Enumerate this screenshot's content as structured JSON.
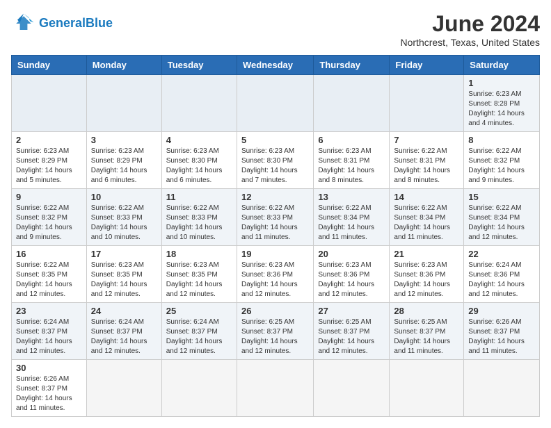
{
  "header": {
    "logo_general": "General",
    "logo_blue": "Blue",
    "month_title": "June 2024",
    "location": "Northcrest, Texas, United States"
  },
  "days_of_week": [
    "Sunday",
    "Monday",
    "Tuesday",
    "Wednesday",
    "Thursday",
    "Friday",
    "Saturday"
  ],
  "weeks": [
    [
      {
        "day": "",
        "sunrise": "",
        "sunset": "",
        "daylight": ""
      },
      {
        "day": "",
        "sunrise": "",
        "sunset": "",
        "daylight": ""
      },
      {
        "day": "",
        "sunrise": "",
        "sunset": "",
        "daylight": ""
      },
      {
        "day": "",
        "sunrise": "",
        "sunset": "",
        "daylight": ""
      },
      {
        "day": "",
        "sunrise": "",
        "sunset": "",
        "daylight": ""
      },
      {
        "day": "",
        "sunrise": "",
        "sunset": "",
        "daylight": ""
      },
      {
        "day": "1",
        "sunrise": "Sunrise: 6:23 AM",
        "sunset": "Sunset: 8:28 PM",
        "daylight": "Daylight: 14 hours and 4 minutes."
      }
    ],
    [
      {
        "day": "2",
        "sunrise": "Sunrise: 6:23 AM",
        "sunset": "Sunset: 8:29 PM",
        "daylight": "Daylight: 14 hours and 5 minutes."
      },
      {
        "day": "3",
        "sunrise": "Sunrise: 6:23 AM",
        "sunset": "Sunset: 8:29 PM",
        "daylight": "Daylight: 14 hours and 6 minutes."
      },
      {
        "day": "4",
        "sunrise": "Sunrise: 6:23 AM",
        "sunset": "Sunset: 8:30 PM",
        "daylight": "Daylight: 14 hours and 6 minutes."
      },
      {
        "day": "5",
        "sunrise": "Sunrise: 6:23 AM",
        "sunset": "Sunset: 8:30 PM",
        "daylight": "Daylight: 14 hours and 7 minutes."
      },
      {
        "day": "6",
        "sunrise": "Sunrise: 6:23 AM",
        "sunset": "Sunset: 8:31 PM",
        "daylight": "Daylight: 14 hours and 8 minutes."
      },
      {
        "day": "7",
        "sunrise": "Sunrise: 6:22 AM",
        "sunset": "Sunset: 8:31 PM",
        "daylight": "Daylight: 14 hours and 8 minutes."
      },
      {
        "day": "8",
        "sunrise": "Sunrise: 6:22 AM",
        "sunset": "Sunset: 8:32 PM",
        "daylight": "Daylight: 14 hours and 9 minutes."
      }
    ],
    [
      {
        "day": "9",
        "sunrise": "Sunrise: 6:22 AM",
        "sunset": "Sunset: 8:32 PM",
        "daylight": "Daylight: 14 hours and 9 minutes."
      },
      {
        "day": "10",
        "sunrise": "Sunrise: 6:22 AM",
        "sunset": "Sunset: 8:33 PM",
        "daylight": "Daylight: 14 hours and 10 minutes."
      },
      {
        "day": "11",
        "sunrise": "Sunrise: 6:22 AM",
        "sunset": "Sunset: 8:33 PM",
        "daylight": "Daylight: 14 hours and 10 minutes."
      },
      {
        "day": "12",
        "sunrise": "Sunrise: 6:22 AM",
        "sunset": "Sunset: 8:33 PM",
        "daylight": "Daylight: 14 hours and 11 minutes."
      },
      {
        "day": "13",
        "sunrise": "Sunrise: 6:22 AM",
        "sunset": "Sunset: 8:34 PM",
        "daylight": "Daylight: 14 hours and 11 minutes."
      },
      {
        "day": "14",
        "sunrise": "Sunrise: 6:22 AM",
        "sunset": "Sunset: 8:34 PM",
        "daylight": "Daylight: 14 hours and 11 minutes."
      },
      {
        "day": "15",
        "sunrise": "Sunrise: 6:22 AM",
        "sunset": "Sunset: 8:34 PM",
        "daylight": "Daylight: 14 hours and 12 minutes."
      }
    ],
    [
      {
        "day": "16",
        "sunrise": "Sunrise: 6:22 AM",
        "sunset": "Sunset: 8:35 PM",
        "daylight": "Daylight: 14 hours and 12 minutes."
      },
      {
        "day": "17",
        "sunrise": "Sunrise: 6:23 AM",
        "sunset": "Sunset: 8:35 PM",
        "daylight": "Daylight: 14 hours and 12 minutes."
      },
      {
        "day": "18",
        "sunrise": "Sunrise: 6:23 AM",
        "sunset": "Sunset: 8:35 PM",
        "daylight": "Daylight: 14 hours and 12 minutes."
      },
      {
        "day": "19",
        "sunrise": "Sunrise: 6:23 AM",
        "sunset": "Sunset: 8:36 PM",
        "daylight": "Daylight: 14 hours and 12 minutes."
      },
      {
        "day": "20",
        "sunrise": "Sunrise: 6:23 AM",
        "sunset": "Sunset: 8:36 PM",
        "daylight": "Daylight: 14 hours and 12 minutes."
      },
      {
        "day": "21",
        "sunrise": "Sunrise: 6:23 AM",
        "sunset": "Sunset: 8:36 PM",
        "daylight": "Daylight: 14 hours and 12 minutes."
      },
      {
        "day": "22",
        "sunrise": "Sunrise: 6:24 AM",
        "sunset": "Sunset: 8:36 PM",
        "daylight": "Daylight: 14 hours and 12 minutes."
      }
    ],
    [
      {
        "day": "23",
        "sunrise": "Sunrise: 6:24 AM",
        "sunset": "Sunset: 8:37 PM",
        "daylight": "Daylight: 14 hours and 12 minutes."
      },
      {
        "day": "24",
        "sunrise": "Sunrise: 6:24 AM",
        "sunset": "Sunset: 8:37 PM",
        "daylight": "Daylight: 14 hours and 12 minutes."
      },
      {
        "day": "25",
        "sunrise": "Sunrise: 6:24 AM",
        "sunset": "Sunset: 8:37 PM",
        "daylight": "Daylight: 14 hours and 12 minutes."
      },
      {
        "day": "26",
        "sunrise": "Sunrise: 6:25 AM",
        "sunset": "Sunset: 8:37 PM",
        "daylight": "Daylight: 14 hours and 12 minutes."
      },
      {
        "day": "27",
        "sunrise": "Sunrise: 6:25 AM",
        "sunset": "Sunset: 8:37 PM",
        "daylight": "Daylight: 14 hours and 12 minutes."
      },
      {
        "day": "28",
        "sunrise": "Sunrise: 6:25 AM",
        "sunset": "Sunset: 8:37 PM",
        "daylight": "Daylight: 14 hours and 11 minutes."
      },
      {
        "day": "29",
        "sunrise": "Sunrise: 6:26 AM",
        "sunset": "Sunset: 8:37 PM",
        "daylight": "Daylight: 14 hours and 11 minutes."
      }
    ],
    [
      {
        "day": "30",
        "sunrise": "Sunrise: 6:26 AM",
        "sunset": "Sunset: 8:37 PM",
        "daylight": "Daylight: 14 hours and 11 minutes."
      },
      {
        "day": "",
        "sunrise": "",
        "sunset": "",
        "daylight": ""
      },
      {
        "day": "",
        "sunrise": "",
        "sunset": "",
        "daylight": ""
      },
      {
        "day": "",
        "sunrise": "",
        "sunset": "",
        "daylight": ""
      },
      {
        "day": "",
        "sunrise": "",
        "sunset": "",
        "daylight": ""
      },
      {
        "day": "",
        "sunrise": "",
        "sunset": "",
        "daylight": ""
      },
      {
        "day": "",
        "sunrise": "",
        "sunset": "",
        "daylight": ""
      }
    ]
  ]
}
